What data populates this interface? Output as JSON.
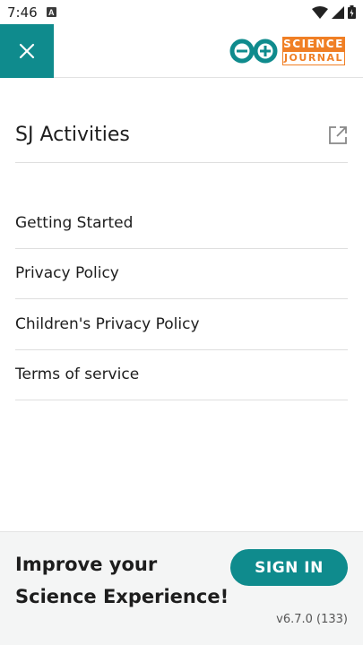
{
  "status_bar": {
    "time": "7:46",
    "notification_badge": "A"
  },
  "header": {
    "close_icon": "close-icon",
    "logo": {
      "word_top": "SCIENCE",
      "word_bottom": "JOURNAL"
    }
  },
  "activities": {
    "label": "SJ Activities",
    "icon": "open-in-new-icon"
  },
  "links": [
    {
      "label": "Getting Started"
    },
    {
      "label": "Privacy Policy"
    },
    {
      "label": "Children's Privacy Policy"
    },
    {
      "label": "Terms of service"
    }
  ],
  "footer": {
    "title_line1": "Improve your",
    "title_line2": "Science Experience!",
    "signin_label": "SIGN IN",
    "version": "v6.7.0 (133)"
  },
  "colors": {
    "teal": "#0f8b8d",
    "orange": "#f07f25"
  }
}
